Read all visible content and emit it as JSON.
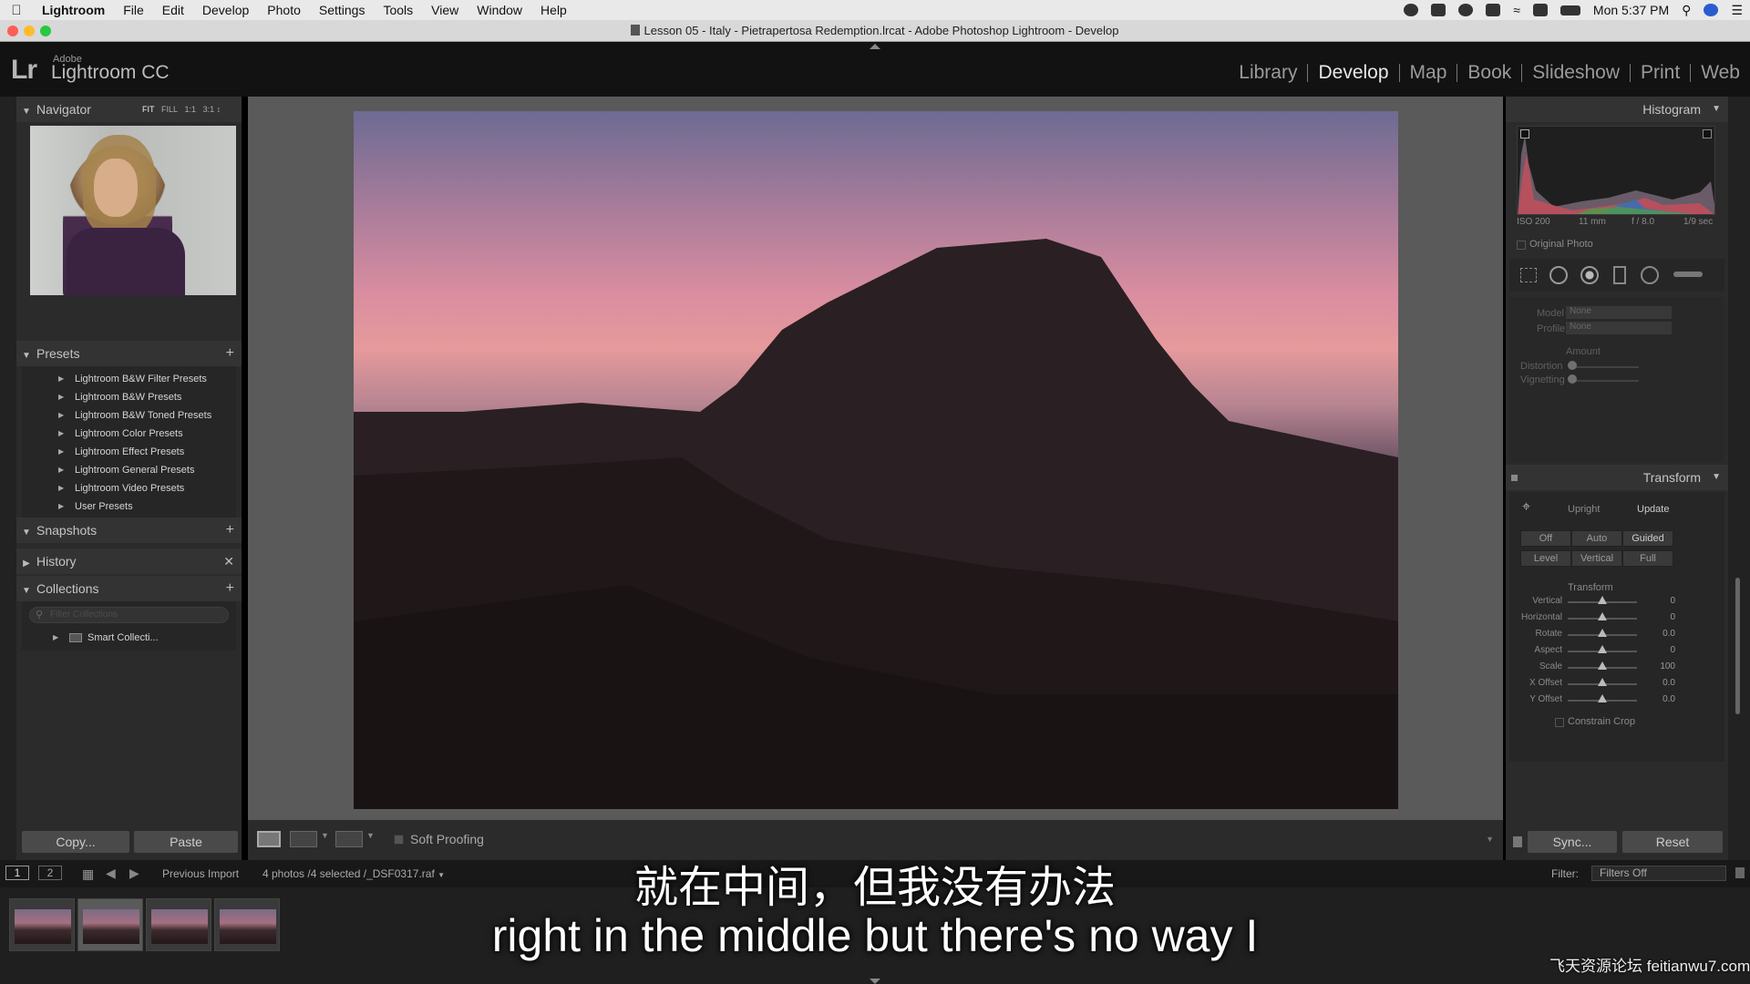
{
  "menubar": {
    "app_name": "Lightroom",
    "items": [
      "File",
      "Edit",
      "Develop",
      "Photo",
      "Settings",
      "Tools",
      "View",
      "Window",
      "Help"
    ],
    "clock": "Mon 5:37 PM"
  },
  "window": {
    "title": "Lesson 05 - Italy - Pietrapertosa Redemption.lrcat - Adobe Photoshop Lightroom - Develop"
  },
  "lr_header": {
    "logo_mark": "Lr",
    "logo_brand": "Adobe",
    "logo_product": "Lightroom CC",
    "modules": [
      "Library",
      "Develop",
      "Map",
      "Book",
      "Slideshow",
      "Print",
      "Web"
    ],
    "active_module": "Develop"
  },
  "left_panel": {
    "navigator": {
      "title": "Navigator",
      "zoom_options": [
        "FIT",
        "FILL",
        "1:1",
        "3:1"
      ]
    },
    "presets": {
      "title": "Presets",
      "items": [
        "Lightroom B&W Filter Presets",
        "Lightroom B&W Presets",
        "Lightroom B&W Toned Presets",
        "Lightroom Color Presets",
        "Lightroom Effect Presets",
        "Lightroom General Presets",
        "Lightroom Video Presets",
        "User Presets"
      ]
    },
    "snapshots": {
      "title": "Snapshots"
    },
    "history": {
      "title": "History"
    },
    "collections": {
      "title": "Collections",
      "filter_placeholder": "Filter Collections",
      "items": [
        "Smart Collecti..."
      ]
    },
    "copy_label": "Copy...",
    "paste_label": "Paste"
  },
  "toolbar": {
    "soft_proofing": "Soft Proofing"
  },
  "right_panel": {
    "histogram": {
      "title": "Histogram",
      "iso": "ISO 200",
      "focal": "11 mm",
      "aperture": "f / 8.0",
      "shutter": "1/9 sec",
      "original_photo": "Original Photo"
    },
    "lens": {
      "model_label": "Model",
      "model_value": "None",
      "profile_label": "Profile",
      "profile_value": "None",
      "amount_label": "Amount",
      "distortion_label": "Distortion",
      "vignetting_label": "Vignetting"
    },
    "transform": {
      "title": "Transform",
      "upright_label": "Upright",
      "update_label": "Update",
      "upright_buttons_row1": [
        "Off",
        "Auto",
        "Guided"
      ],
      "upright_buttons_row2": [
        "Level",
        "Vertical",
        "Full"
      ],
      "section_label": "Transform",
      "sliders": [
        {
          "label": "Vertical",
          "value": "0"
        },
        {
          "label": "Horizontal",
          "value": "0"
        },
        {
          "label": "Rotate",
          "value": "0.0"
        },
        {
          "label": "Aspect",
          "value": "0"
        },
        {
          "label": "Scale",
          "value": "100"
        },
        {
          "label": "X Offset",
          "value": "0.0"
        },
        {
          "label": "Y Offset",
          "value": "0.0"
        }
      ],
      "constrain_crop": "Constrain Crop"
    },
    "sync_label": "Sync...",
    "reset_label": "Reset"
  },
  "filmstrip_bar": {
    "view1": "1",
    "view2": "2",
    "source": "Previous Import",
    "info": "4 photos /4 selected /_DSF0317.raf",
    "filter_label": "Filter:",
    "filter_value": "Filters Off"
  },
  "subtitles": {
    "zh": "就在中间，但我没有办法",
    "en": "right in the middle but there's no way I"
  },
  "watermark": "飞天资源论坛 feitianwu7.com"
}
